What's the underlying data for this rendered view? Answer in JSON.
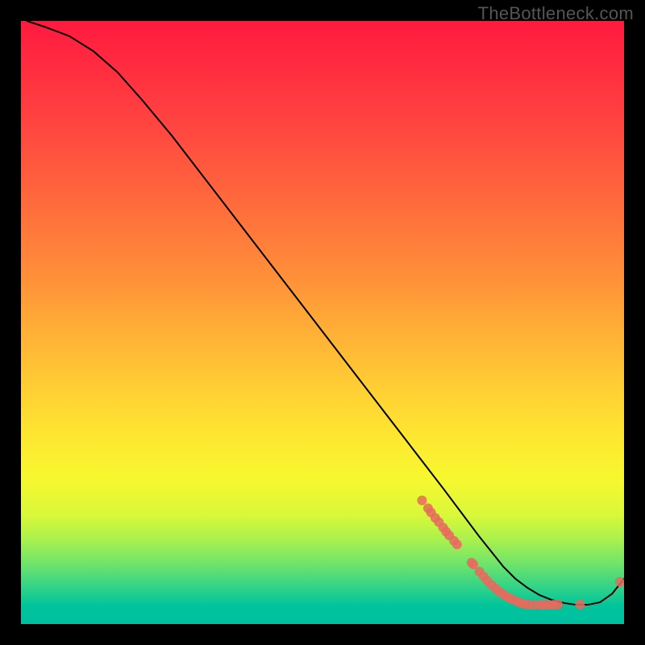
{
  "watermark": "TheBottleneck.com",
  "chart_data": {
    "type": "line",
    "title": "",
    "xlabel": "",
    "ylabel": "",
    "xlim": [
      0,
      100
    ],
    "ylim": [
      0,
      100
    ],
    "grid": false,
    "legend": false,
    "series": [
      {
        "name": "curve",
        "x": [
          1,
          4,
          8,
          12,
          16,
          20,
          25,
          30,
          35,
          40,
          45,
          50,
          55,
          60,
          65,
          70,
          73,
          76,
          78,
          80,
          82,
          84,
          86,
          88,
          90,
          92,
          94,
          96,
          98,
          100
        ],
        "y": [
          100,
          99,
          97.5,
          95,
          91.5,
          87,
          81,
          74.5,
          68,
          61.5,
          55,
          48.5,
          42,
          35.5,
          29,
          22.5,
          18.5,
          14.5,
          12,
          9.5,
          7.5,
          6,
          4.8,
          4,
          3.5,
          3.2,
          3.2,
          3.6,
          5,
          7.5
        ]
      }
    ],
    "scatter_points": {
      "name": "markers",
      "x": [
        66.5,
        67.5,
        68.0,
        68.7,
        69.3,
        70.0,
        70.5,
        71.0,
        71.8,
        72.3,
        74.7,
        75.0,
        76.0,
        76.7,
        77.3,
        78.0,
        78.7,
        79.3,
        80.0,
        80.7,
        81.3,
        82.0,
        82.7,
        83.3,
        84.0,
        85.0,
        86.0,
        86.7,
        87.5,
        88.3,
        89.0,
        92.7,
        99.3
      ],
      "y": [
        20.5,
        19.2,
        18.5,
        17.6,
        16.9,
        16.0,
        15.3,
        14.7,
        13.8,
        13.2,
        10.2,
        9.9,
        8.7,
        7.9,
        7.2,
        6.5,
        5.9,
        5.4,
        4.9,
        4.5,
        4.2,
        3.9,
        3.6,
        3.4,
        3.3,
        3.2,
        3.2,
        3.2,
        3.2,
        3.2,
        3.3,
        3.3,
        7.0
      ]
    },
    "colors": {
      "curve": "#000000",
      "markers": "#e86a5e"
    }
  }
}
